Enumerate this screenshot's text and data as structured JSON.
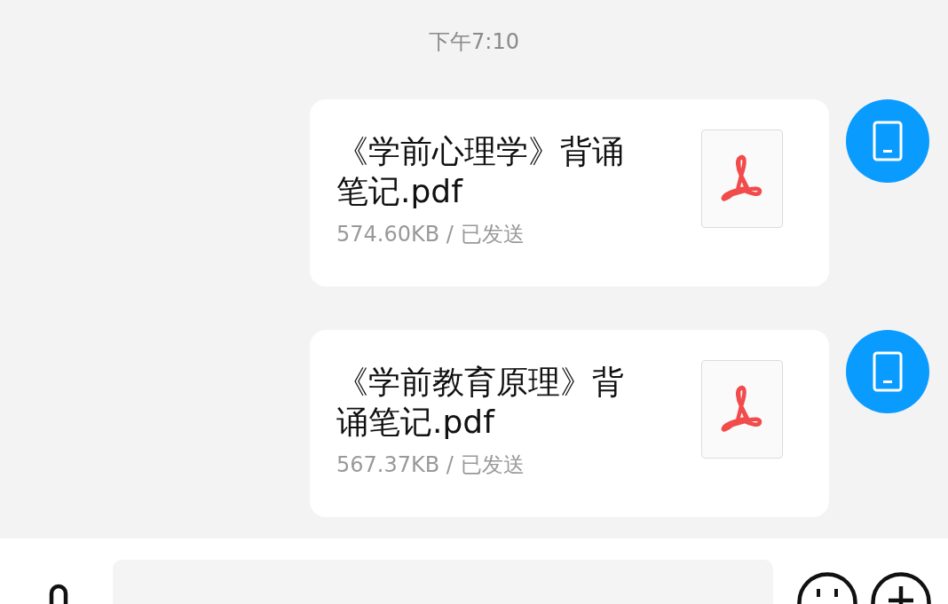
{
  "time": "下午7:10",
  "messages": [
    {
      "title": "《学前心理学》背诵笔记.pdf",
      "meta": "574.60KB / 已发送"
    },
    {
      "title": "《学前教育原理》背诵笔记.pdf",
      "meta": "567.37KB / 已发送"
    }
  ]
}
